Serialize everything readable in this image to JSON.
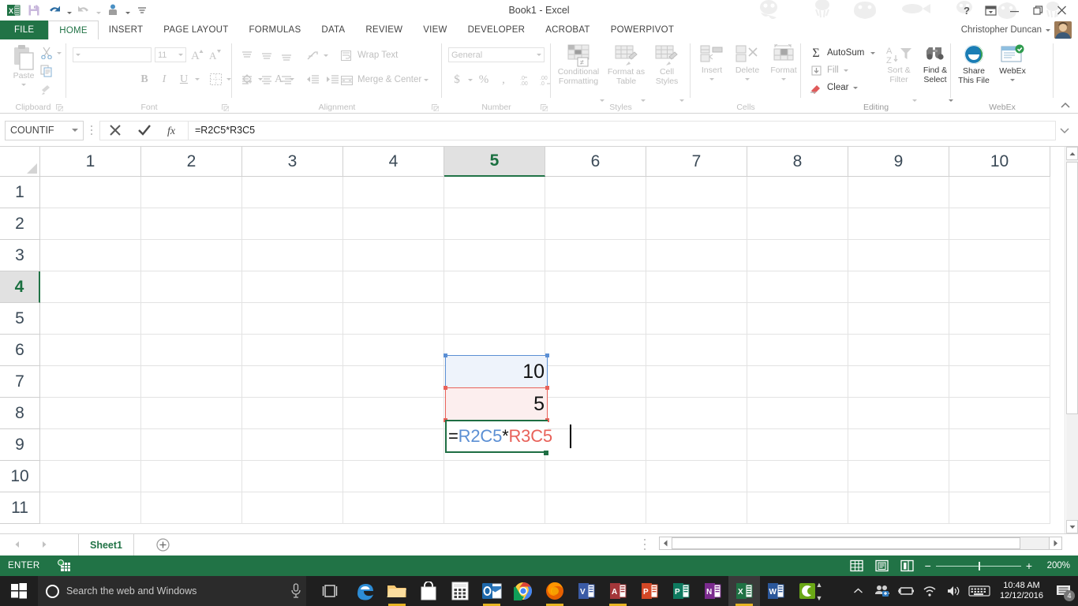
{
  "titlebar": {
    "title": "Book1 - Excel",
    "quick_access": [
      {
        "name": "excel-logo-icon",
        "label": "Excel"
      },
      {
        "name": "save-icon",
        "label": "Save"
      },
      {
        "name": "undo-icon",
        "label": "Undo"
      },
      {
        "name": "redo-icon",
        "label": "Redo"
      },
      {
        "name": "touch-mode-icon",
        "label": "Touch/Mouse Mode"
      },
      {
        "name": "customize-qat-icon",
        "label": "Customize Quick Access Toolbar"
      }
    ],
    "window_controls": [
      {
        "name": "help-button",
        "glyph": "?"
      },
      {
        "name": "ribbon-display-options-button",
        "glyph": "⤒"
      },
      {
        "name": "minimize-button",
        "glyph": "—"
      },
      {
        "name": "restore-button",
        "glyph": "❐"
      },
      {
        "name": "close-button",
        "glyph": "✕"
      }
    ]
  },
  "tabs": [
    {
      "label": "FILE",
      "state": "file"
    },
    {
      "label": "HOME",
      "state": "active"
    },
    {
      "label": "INSERT",
      "state": "normal"
    },
    {
      "label": "PAGE LAYOUT",
      "state": "normal"
    },
    {
      "label": "FORMULAS",
      "state": "normal"
    },
    {
      "label": "DATA",
      "state": "normal"
    },
    {
      "label": "REVIEW",
      "state": "normal"
    },
    {
      "label": "VIEW",
      "state": "normal"
    },
    {
      "label": "DEVELOPER",
      "state": "normal"
    },
    {
      "label": "ACROBAT",
      "state": "normal"
    },
    {
      "label": "POWERPIVOT",
      "state": "normal"
    }
  ],
  "account": {
    "name": "Christopher Duncan"
  },
  "ribbon": {
    "groups": [
      {
        "name": "Clipboard"
      },
      {
        "name": "Font"
      },
      {
        "name": "Alignment"
      },
      {
        "name": "Number"
      },
      {
        "name": "Styles"
      },
      {
        "name": "Cells"
      },
      {
        "name": "Editing"
      },
      {
        "name": "WebEx"
      }
    ],
    "clipboard": {
      "paste": "Paste"
    },
    "font": {
      "font_name": "",
      "font_size": "11"
    },
    "alignment": {
      "wrap_text": "Wrap Text",
      "merge_center": "Merge & Center"
    },
    "number": {
      "format": "General"
    },
    "styles": {
      "conditional_formatting_l1": "Conditional",
      "conditional_formatting_l2": "Formatting",
      "format_as_table_l1": "Format as",
      "format_as_table_l2": "Table",
      "cell_styles_l1": "Cell",
      "cell_styles_l2": "Styles"
    },
    "cells": {
      "insert": "Insert",
      "delete": "Delete",
      "format": "Format"
    },
    "editing": {
      "autosum": "AutoSum",
      "fill": "Fill",
      "clear": "Clear",
      "sort_filter_l1": "Sort &",
      "sort_filter_l2": "Filter",
      "find_select_l1": "Find &",
      "find_select_l2": "Select"
    },
    "webex": {
      "share_l1": "Share",
      "share_l2": "This File",
      "webex_l1": "WebEx",
      "webex_l2": ""
    }
  },
  "formula_bar": {
    "name_box_value": "COUNTIF",
    "cancel_label": "Cancel",
    "enter_label": "Enter",
    "fx_label": "Insert Function",
    "formula": "=R2C5*R3C5"
  },
  "grid": {
    "column_headers": [
      "1",
      "2",
      "3",
      "4",
      "5",
      "6",
      "7",
      "8",
      "9",
      "10"
    ],
    "row_headers": [
      "1",
      "2",
      "3",
      "4",
      "5",
      "6",
      "7",
      "8",
      "9",
      "10",
      "11"
    ],
    "selected_column": "5",
    "selected_row": "4",
    "reference_style": "R1C1",
    "cells": [
      {
        "row": 2,
        "col": 5,
        "value": "10",
        "highlight": "blue"
      },
      {
        "row": 3,
        "col": 5,
        "value": "5",
        "highlight": "red"
      }
    ],
    "editing_cell": {
      "row": 4,
      "col": 5,
      "tokens": [
        {
          "text": "=",
          "color": "#111111"
        },
        {
          "text": "R2C5",
          "color": "#5B8FD4"
        },
        {
          "text": "*",
          "color": "#111111"
        },
        {
          "text": "R3C5",
          "color": "#E8625A"
        }
      ]
    },
    "colors": {
      "blue_ref": "#5B8FD4",
      "red_ref": "#E8625A",
      "edit_border": "#1E6E43",
      "blue_fill": "#EEF3FB",
      "red_fill": "#FCEEEE",
      "header_selected": "#217346"
    }
  },
  "sheet_bar": {
    "sheets": [
      {
        "label": "Sheet1",
        "active": true
      }
    ],
    "add_sheet_label": "New sheet"
  },
  "status_bar": {
    "mode": "ENTER",
    "macro_label": "Record Macro",
    "views": [
      "normal-view",
      "page-layout-view",
      "page-break-preview"
    ],
    "zoom_out_label": "−",
    "zoom_in_label": "+",
    "zoom": "200%"
  },
  "taskbar": {
    "search_placeholder": "Search the web and Windows",
    "apps": [
      {
        "name": "edge-icon",
        "label": "Microsoft Edge",
        "running": false
      },
      {
        "name": "file-explorer-icon",
        "label": "File Explorer",
        "running": true
      },
      {
        "name": "store-icon",
        "label": "Store",
        "running": false
      },
      {
        "name": "calculator-icon",
        "label": "Calculator",
        "running": false
      },
      {
        "name": "outlook-icon",
        "label": "Outlook",
        "running": true
      },
      {
        "name": "chrome-icon",
        "label": "Google Chrome",
        "running": false
      },
      {
        "name": "firefox-icon",
        "label": "Firefox",
        "running": true
      },
      {
        "name": "visio-icon",
        "label": "Visio",
        "running": false
      },
      {
        "name": "access-icon",
        "label": "Access",
        "running": true
      },
      {
        "name": "powerpoint-icon",
        "label": "PowerPoint",
        "running": false
      },
      {
        "name": "publisher-icon",
        "label": "Publisher",
        "running": false
      },
      {
        "name": "onenote-icon",
        "label": "OneNote",
        "running": false
      },
      {
        "name": "excel-icon",
        "label": "Excel",
        "running": true,
        "active": true
      },
      {
        "name": "word-icon",
        "label": "Word",
        "running": false
      },
      {
        "name": "camtasia-icon",
        "label": "Camtasia",
        "running": false
      }
    ],
    "tray": {
      "time": "10:48 AM",
      "date": "12/12/2016",
      "notification_count": "4"
    }
  }
}
